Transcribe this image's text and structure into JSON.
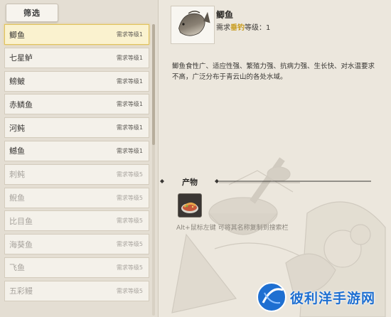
{
  "filter": {
    "label": "筛选"
  },
  "fish_list": [
    {
      "name": "鲫鱼",
      "requirement": "需求等级1",
      "selected": true,
      "locked": false
    },
    {
      "name": "七星鲈",
      "requirement": "需求等级1",
      "selected": false,
      "locked": false
    },
    {
      "name": "鳑鲏",
      "requirement": "需求等级1",
      "selected": false,
      "locked": false
    },
    {
      "name": "赤鳞鱼",
      "requirement": "需求等级1",
      "selected": false,
      "locked": false
    },
    {
      "name": "河鲀",
      "requirement": "需求等级1",
      "selected": false,
      "locked": false
    },
    {
      "name": "鳡鱼",
      "requirement": "需求等级1",
      "selected": false,
      "locked": false
    },
    {
      "name": "刺鲀",
      "requirement": "需求等级5",
      "selected": false,
      "locked": true
    },
    {
      "name": "鲵鱼",
      "requirement": "需求等级5",
      "selected": false,
      "locked": true
    },
    {
      "name": "比目鱼",
      "requirement": "需求等级5",
      "selected": false,
      "locked": true
    },
    {
      "name": "海葵鱼",
      "requirement": "需求等级5",
      "selected": false,
      "locked": true
    },
    {
      "name": "飞鱼",
      "requirement": "需求等级5",
      "selected": false,
      "locked": true
    },
    {
      "name": "五彩鳗",
      "requirement": "需求等级5",
      "selected": false,
      "locked": true
    }
  ],
  "detail": {
    "name": "鲫鱼",
    "requirement_prefix": "需求",
    "requirement_skill": "垂钓",
    "requirement_suffix": "等级：1",
    "description": "鲫鱼食性广、适应性强、繁殖力强、抗病力强、生长快、对水温要求不高，广泛分布于青云山的各处水域。"
  },
  "products": {
    "title": "产物",
    "hint": "Alt+鼠标左键 可将其名称复制到搜索栏",
    "item_icon": "cooked-fish-dish-icon"
  },
  "watermark": {
    "text": "彼利洋手游网"
  },
  "colors": {
    "selected_border": "#e2c35a",
    "skill_highlight": "#c79a1a",
    "watermark_blue": "#1e6fd1"
  }
}
